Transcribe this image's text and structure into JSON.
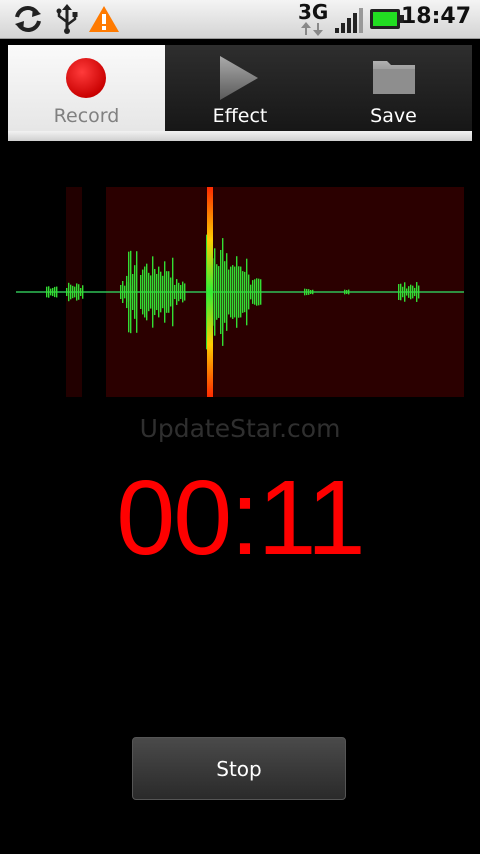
{
  "status_bar": {
    "network": "3G",
    "time": "18:47",
    "icons": [
      "sync-icon",
      "usb-icon",
      "warning-icon",
      "data-arrows-icon",
      "signal-icon",
      "battery-icon"
    ]
  },
  "tabs": [
    {
      "id": "record",
      "label": "Record",
      "icon": "record-icon",
      "selected": true
    },
    {
      "id": "effect",
      "label": "Effect",
      "icon": "play-icon",
      "selected": false
    },
    {
      "id": "save",
      "label": "Save",
      "icon": "folder-icon",
      "selected": false
    }
  ],
  "watermark": "UpdateStar.com",
  "timer": "00:11",
  "stop_button": {
    "label": "Stop"
  },
  "colors": {
    "timer": "#ff0000",
    "waveform": "#33dd33",
    "waveform_peak": "#ff3300",
    "waveform_bg": "#2a0000",
    "record_dot": "#e01010"
  }
}
